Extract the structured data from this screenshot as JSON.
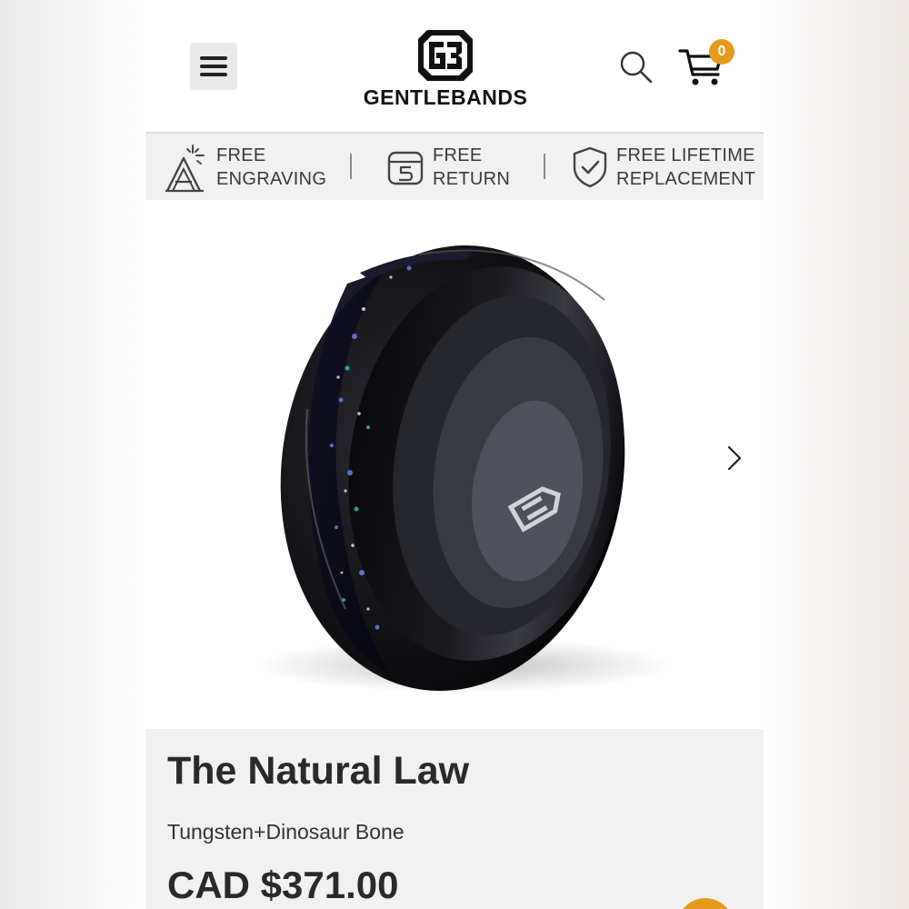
{
  "header": {
    "brand_name": "GENTLEBANDS",
    "cart_count": "0",
    "accent_color": "#e69a1c",
    "menu_icon": "hamburger-menu-icon",
    "search_icon": "search-icon",
    "cart_icon": "shopping-cart-icon"
  },
  "benefits": [
    {
      "line1": "FREE",
      "line2": "ENGRAVING",
      "icon": "engraving-icon"
    },
    {
      "line1": "FREE",
      "line2": "RETURN",
      "icon": "return-box-icon"
    },
    {
      "line1": "FREE LIFETIME",
      "line2": "REPLACEMENT",
      "icon": "shield-check-icon"
    }
  ],
  "product": {
    "title": "The Natural Law",
    "material": "Tungsten+Dinosaur Bone",
    "price": "CAD $371.00",
    "image_icon": "ring-product-image",
    "next_icon": "chevron-right-icon"
  }
}
